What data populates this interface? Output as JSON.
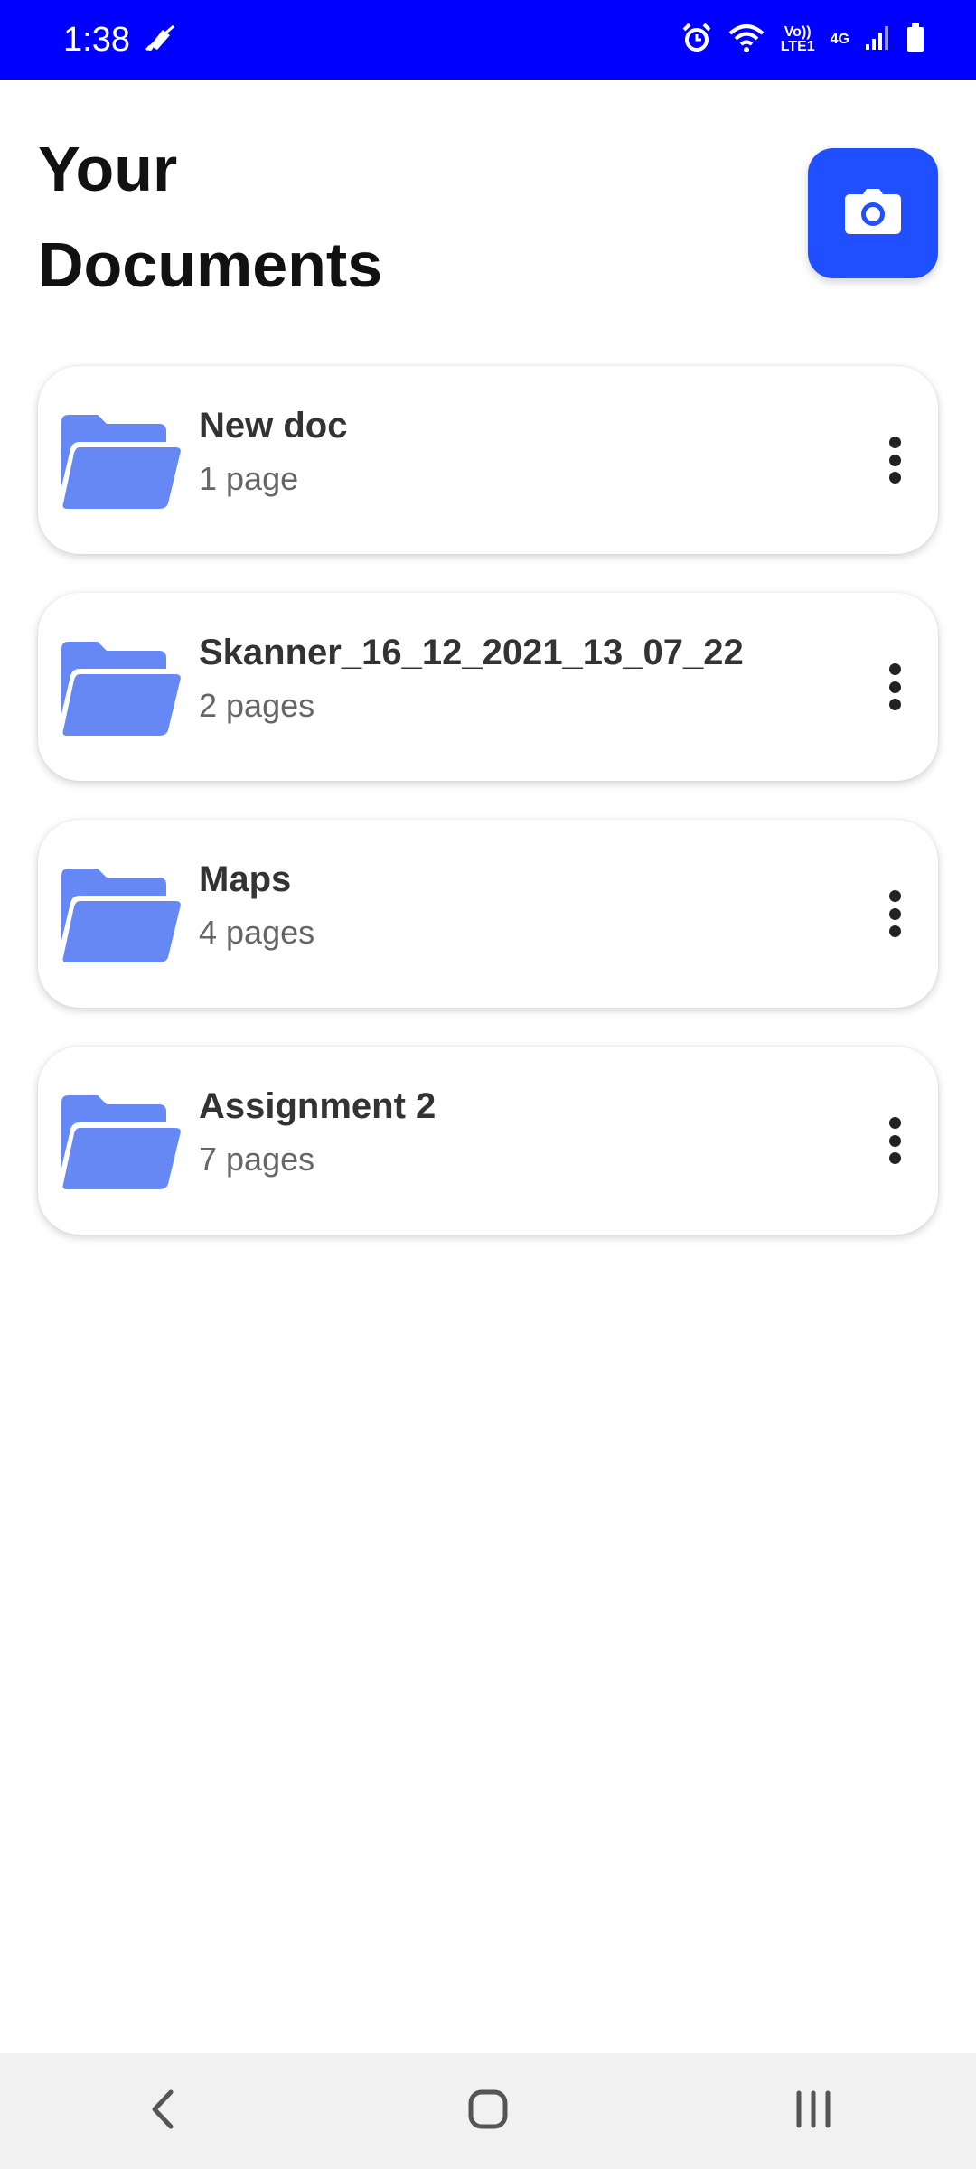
{
  "status_bar": {
    "time": "1:38",
    "network_top": "Vo)) LTE1",
    "network_type": "4G"
  },
  "header": {
    "title_line1": "Your",
    "title_line2": "Documents",
    "camera_icon": "camera-icon"
  },
  "documents": [
    {
      "name": "New doc",
      "pages": "1 page"
    },
    {
      "name": "Skanner_16_12_2021_13_07_22",
      "pages": "2 pages"
    },
    {
      "name": "Maps",
      "pages": "4 pages"
    },
    {
      "name": "Assignment 2",
      "pages": "7 pages"
    }
  ],
  "colors": {
    "status_bar": "#0000ff",
    "accent": "#1f4fff",
    "folder": "#6688f5"
  },
  "nav_bar": {
    "back_icon": "back-icon",
    "home_icon": "home-icon",
    "recents_icon": "recents-icon"
  }
}
